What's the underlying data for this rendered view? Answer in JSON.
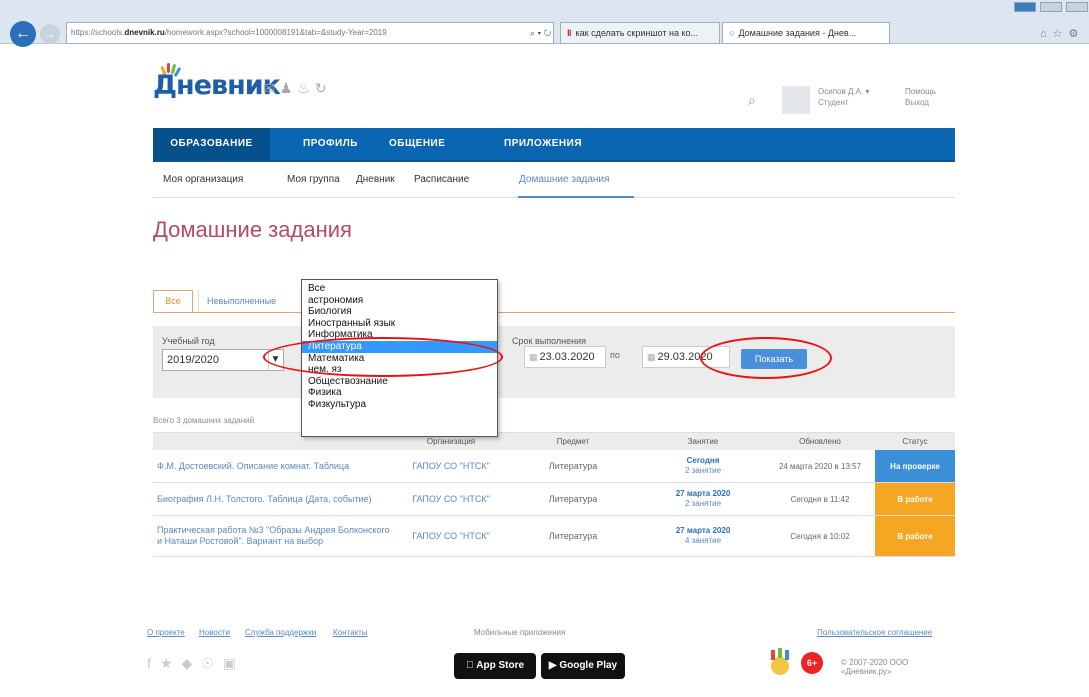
{
  "browser": {
    "address_prefix": "https://schools.",
    "address_domain": "dnevnik.ru",
    "address_rest": "/homework.aspx?school=1000008191&tab=&study-Year=2019",
    "address_controls": "⌕ ▾ ↻",
    "tab1_label": "как сделать скриншот на ко...",
    "tab2_label": "Домашние задания - Днев..."
  },
  "site": {
    "logo": "Дневник",
    "search_icon": "⌕",
    "user_name": "Осипов Д.А. ▾",
    "user_role": "Студент",
    "help": "Помощь",
    "logout": "Выход"
  },
  "nav": {
    "items": [
      "ОБРАЗОВАНИЕ",
      "ПРОФИЛЬ",
      "ОБЩЕНИЕ",
      "ПРИЛОЖЕНИЯ"
    ]
  },
  "subnav": {
    "items": [
      "Моя организация",
      "Моя группа",
      "Дневник",
      "Расписание",
      "Домашние задания"
    ]
  },
  "page": {
    "title": "Домашние задания",
    "filter_tabs": [
      "Все",
      "Невыполненные"
    ],
    "year_label": "Учебный год",
    "year_value": "2019/2020",
    "deadline_label": "Срок выполнения",
    "date_from": "23.03.2020",
    "date_to_label": "по",
    "date_to": "29.03.2020",
    "show_button": "Показать",
    "total_count": "Всего 3 домашних заданий"
  },
  "subject_dropdown": {
    "options": [
      "Все",
      "астрономия",
      "Биология",
      "Иностранный язык",
      "Информатика",
      "Литература",
      "Математика",
      "нем. яз",
      "Обществознание",
      "Физика",
      "Физкультура"
    ],
    "selected_index": 5
  },
  "table": {
    "headers": [
      "",
      "Организация",
      "Предмет",
      "Занятие",
      "Обновлено",
      "Статус"
    ],
    "rows": [
      {
        "work": "Ф.М. Достоевский. Описание комнат. Таблица",
        "org": "ГАПОУ СО \"НТСК\"",
        "subject": "Литература",
        "lesson_date": "Сегодня",
        "lesson_num": "2 занятие",
        "updated": "24 марта 2020 в 13:57",
        "status": "На проверке",
        "status_color": "#3a8fd6"
      },
      {
        "work": "Биография Л.Н. Толстого. Таблица (Дата, событие)",
        "org": "ГАПОУ СО \"НТСК\"",
        "subject": "Литература",
        "lesson_date": "27 марта 2020",
        "lesson_num": "2 занятие",
        "updated": "Сегодня в 11:42",
        "status": "В работе",
        "status_color": "#f5a623"
      },
      {
        "work": "Практическая работа №3 \"Образы Андрея Болконского и Наташи Ростовой\". Вариант на выбор",
        "org": "ГАПОУ СО \"НТСК\"",
        "subject": "Литература",
        "lesson_date": "27 марта 2020",
        "lesson_num": "4 занятие",
        "updated": "Сегодня в 10:02",
        "status": "В работе",
        "status_color": "#f5a623"
      }
    ]
  },
  "footer": {
    "links": [
      "О проекте",
      "Новости",
      "Служба поддержки",
      "Контакты"
    ],
    "mobile_label": "Мобильные приложения",
    "appstore": "App Store",
    "googleplay": "Google Play",
    "agreement": "Пользовательское соглашение",
    "age": "6+",
    "copyright": "© 2007-2020 ООО «Дневник.ру»"
  },
  "colors": {
    "nav_blue": "#0a66b0",
    "title_pink": "#b84a62",
    "annotation_red": "#e11111",
    "selection_blue": "#3399ff"
  }
}
